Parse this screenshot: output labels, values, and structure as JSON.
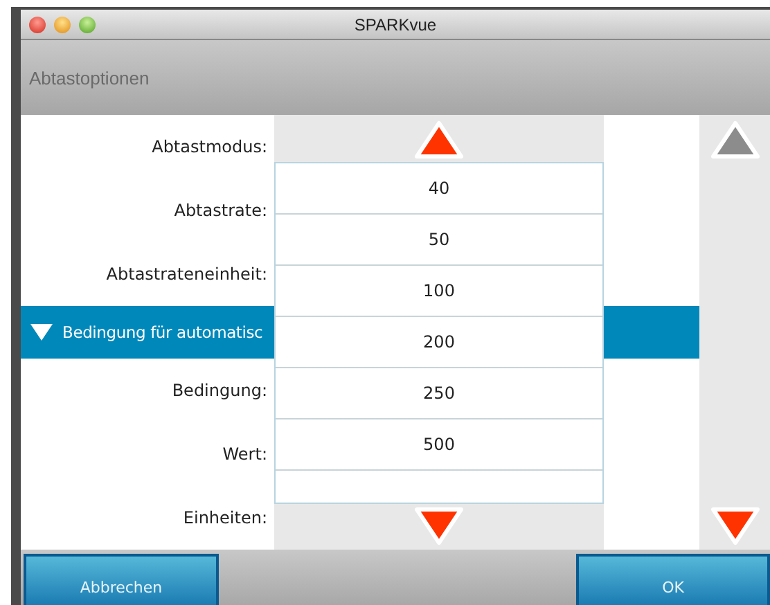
{
  "window": {
    "title": "SPARKvue"
  },
  "header": {
    "title": "Abtastoptionen"
  },
  "fields": [
    {
      "label": "Abtastmodus:"
    },
    {
      "label": "Abtastrate:"
    },
    {
      "label": "Abtastrateneinheit:"
    }
  ],
  "section": {
    "label": "Bedingung für automatisc",
    "expanded": true
  },
  "section_fields": [
    {
      "label": "Bedingung:"
    },
    {
      "label": "Wert:"
    },
    {
      "label": "Einheiten:"
    }
  ],
  "picker": {
    "up_disabled": false,
    "down_disabled": false,
    "options": [
      "40",
      "50",
      "100",
      "200",
      "250",
      "500"
    ]
  },
  "page_scroll": {
    "up_disabled": true,
    "down_disabled": false
  },
  "buttons": [
    {
      "label": "Abbrechen"
    },
    {
      "label": "OK"
    }
  ]
}
